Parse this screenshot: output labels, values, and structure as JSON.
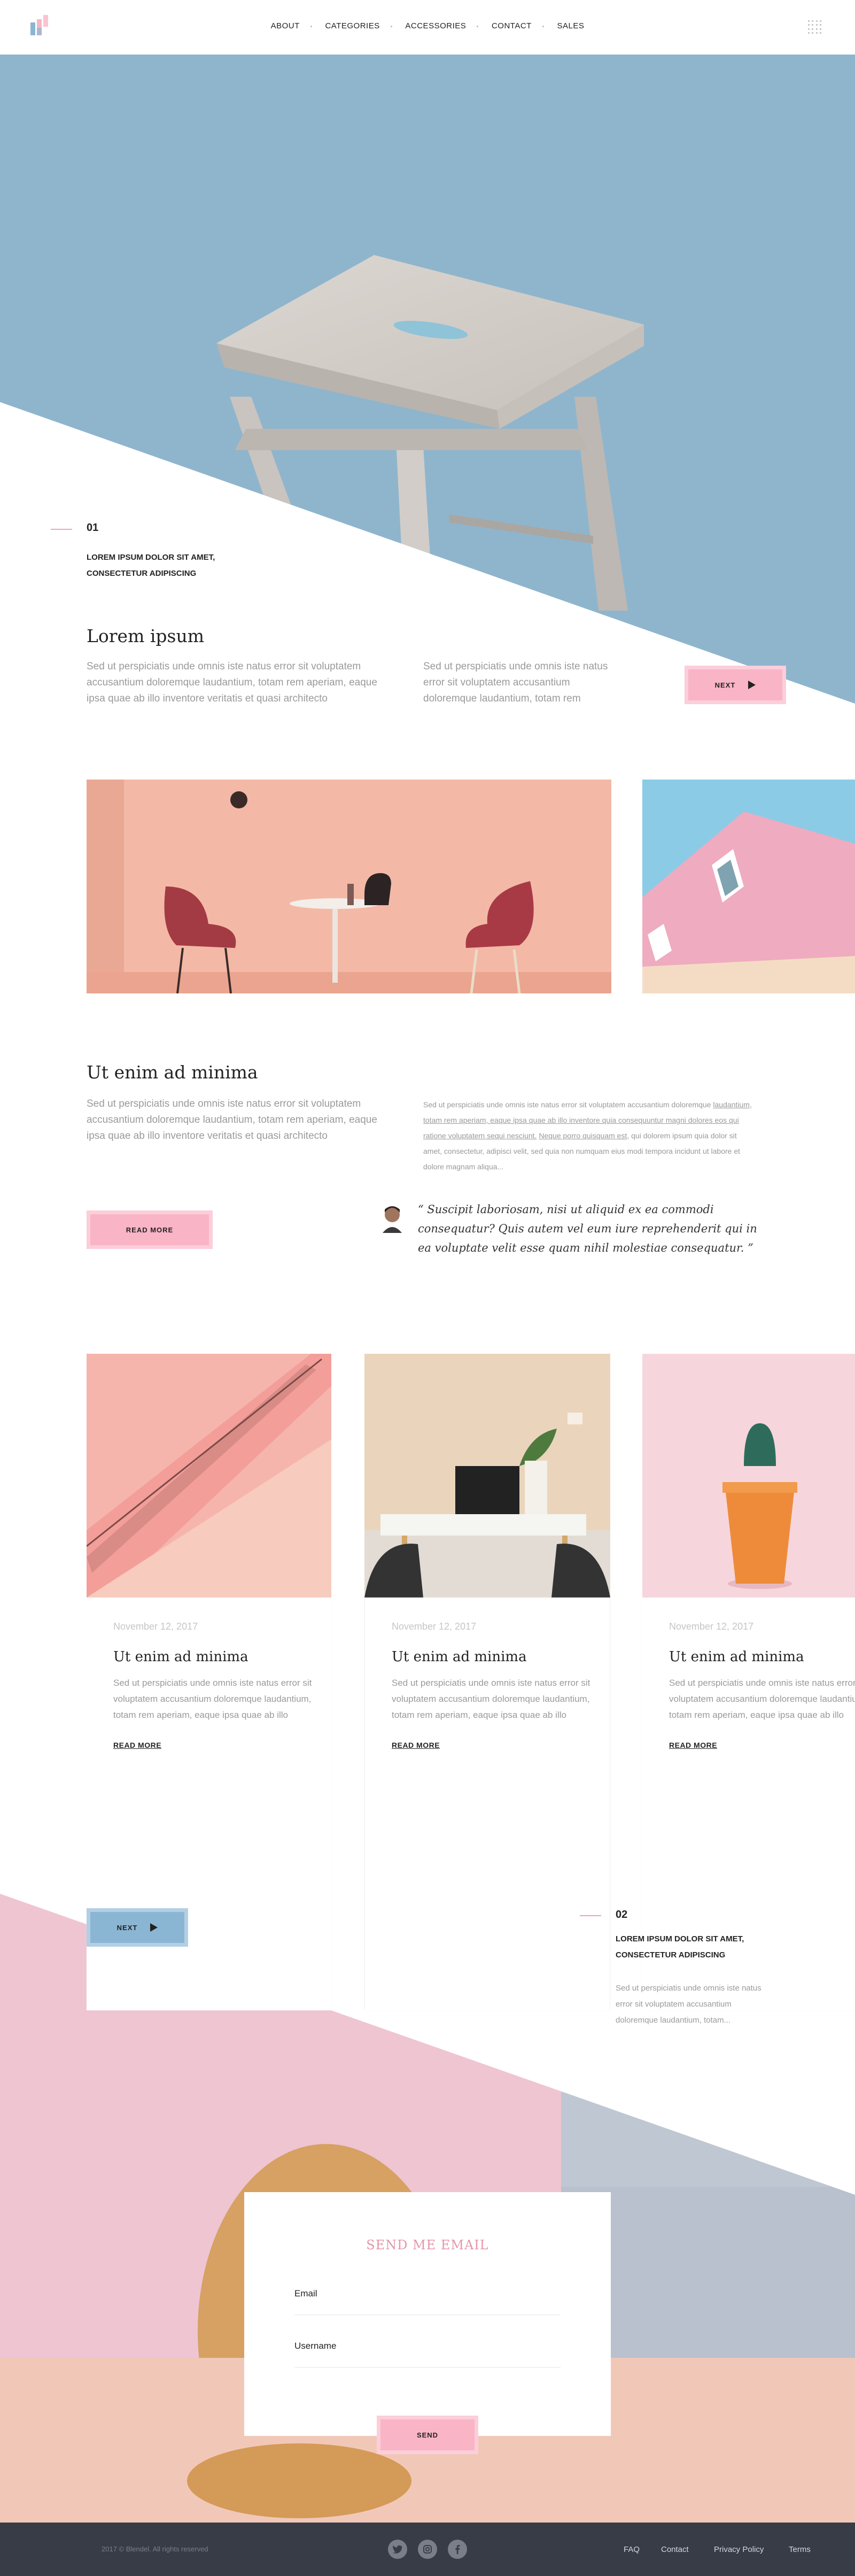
{
  "nav": {
    "items": [
      "ABOUT",
      "CATEGORIES",
      "ACCESSORIES",
      "CONTACT",
      "SALES"
    ]
  },
  "icons": {
    "logo": "logo-icon",
    "menu": "grid-menu-icon",
    "play": "play-icon",
    "twitter": "twitter-icon",
    "instagram": "instagram-icon",
    "facebook": "facebook-icon"
  },
  "colors": {
    "accent_pink": "#f9b4c6",
    "accent_blue": "#8ab6d4",
    "hero_sky": "#8fb5cd",
    "footer": "#383c47"
  },
  "hero": {
    "number": "01",
    "subtitle_line1": "LOREM IPSUM DOLOR SIT AMET,",
    "subtitle_line2": "CONSECTETUR ADIPISCING",
    "title": "Lorem ipsum",
    "text1": "Sed ut perspiciatis unde omnis iste natus error sit voluptatem accusantium doloremque laudantium, totam rem aperiam, eaque ipsa quae ab illo inventore veritatis et quasi architecto",
    "text2": "Sed ut perspiciatis unde omnis iste natus error sit voluptatem accusantium doloremque laudantium, totam rem",
    "next_label": "NEXT"
  },
  "section2": {
    "title": "Ut enim ad minima",
    "text": "Sed ut perspiciatis unde omnis iste natus error sit voluptatem accusantium doloremque laudantium, totam rem aperiam, eaque ipsa quae ab illo inventore veritatis et quasi architecto",
    "right_text_plain1": "Sed ut perspiciatis unde omnis iste natus error sit voluptatem accusantium doloremque",
    "right_text_link1": "laudantium, totam rem aperiam, eaque ipsa quae ab illo inventore quia consequuntur magni dolores eos qui ratione voluptatem sequi nesciunt.",
    "right_text_link2": "Neque porro quisquam est,",
    "right_text_plain2": "qui dolorem ipsum quia dolor sit amet, consectetur, adipisci velit, sed quia non numquam eius modi tempora incidunt ut labore et dolore magnam aliqua...",
    "read_more_label": "READ MORE",
    "quote": "“ Suscipit laboriosam, nisi ut aliquid ex ea commodi consequatur? Quis autem vel eum iure reprehenderit qui in ea voluptate velit esse quam nihil molestiae consequatur. ”"
  },
  "cards": [
    {
      "date": "November 12, 2017",
      "title": "Ut enim ad minima",
      "text": "Sed ut perspiciatis unde omnis iste natus error sit voluptatem accusantium doloremque laudantium, totam rem aperiam, eaque ipsa quae ab illo",
      "link": "READ MORE"
    },
    {
      "date": "November 12, 2017",
      "title": "Ut enim ad minima",
      "text": "Sed ut perspiciatis unde omnis iste natus error sit voluptatem accusantium doloremque laudantium, totam rem aperiam, eaque ipsa quae ab illo",
      "link": "READ MORE"
    },
    {
      "date": "November 12, 2017",
      "title": "Ut enim ad minima",
      "text": "Sed ut perspiciatis unde omnis iste natus error sit voluptatem accusantium doloremque laudantium, totam rem aperiam, eaque ipsa quae ab illo",
      "link": "READ MORE"
    }
  ],
  "section3": {
    "next_label": "NEXT",
    "number": "02",
    "subtitle_line1": "LOREM IPSUM DOLOR SIT AMET,",
    "subtitle_line2": "CONSECTETUR ADIPISCING",
    "text": "Sed ut perspiciatis unde omnis iste natus error sit voluptatem accusantium doloremque laudantium, totam..."
  },
  "form": {
    "title": "SEND ME EMAIL",
    "email_label": "Email",
    "username_label": "Username",
    "send_label": "SEND"
  },
  "footer": {
    "copyright": "2017 © Blendel. All rights reserved",
    "links": [
      "FAQ",
      "Contact",
      "Privacy Policy",
      "Terms"
    ]
  }
}
